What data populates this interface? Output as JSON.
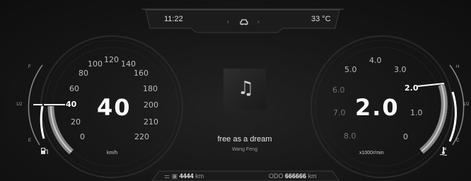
{
  "header": {
    "time": "11:22",
    "temperature": "33 °C"
  },
  "speedometer": {
    "value": "40",
    "unit": "km/h",
    "ticks": [
      "0",
      "20",
      "40",
      "60",
      "80",
      "100",
      "120",
      "140",
      "160",
      "180",
      "200",
      "210",
      "220"
    ]
  },
  "fuel": {
    "full": "F",
    "half": "1/2",
    "empty": "E",
    "level": 0.45
  },
  "tachometer": {
    "value": "2.0",
    "unit": "x1000r/min",
    "ticks": [
      "0",
      "1.0",
      "2.0",
      "3.0",
      "4.0",
      "5.0",
      "6.0",
      "7.0",
      "8.0"
    ]
  },
  "coolant": {
    "hot": "H",
    "half": "1/2",
    "cold": "C",
    "level": 0.6
  },
  "media": {
    "song_title": "free as a dream",
    "artist": "Wang Feng"
  },
  "trip": {
    "range_value": "4444",
    "range_unit": "km",
    "odo_label": "ODO",
    "odo_value": "666666",
    "odo_unit": "km"
  },
  "colors": {
    "accent": "#ffffff",
    "gauge_fill": "#b0b0b0",
    "background": "#141414"
  },
  "icons": [
    "car-icon",
    "chevron-left-icon",
    "chevron-right-icon",
    "music-note-icon",
    "fuel-pump-icon",
    "coolant-temp-icon"
  ]
}
